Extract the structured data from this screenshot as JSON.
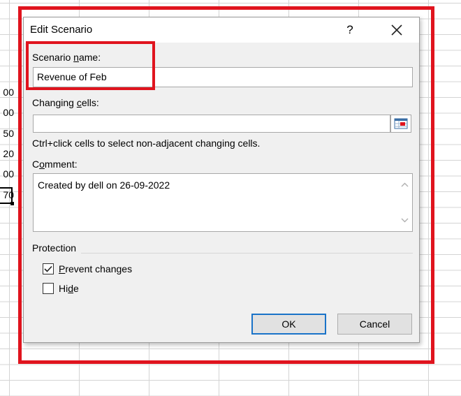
{
  "sheet": {
    "visible_values": [
      "00",
      "00",
      "50",
      "20",
      "00",
      "70"
    ]
  },
  "dialog": {
    "title": "Edit Scenario",
    "help_glyph": "?",
    "close_glyph": "×",
    "scenario_name": {
      "label_pre": "Scenario ",
      "label_accel": "n",
      "label_post": "ame:",
      "value": "Revenue of Feb"
    },
    "changing_cells": {
      "label_pre": "Changing ",
      "label_accel": "c",
      "label_post": "ells:",
      "value": ""
    },
    "hint": "Ctrl+click cells to select non-adjacent changing cells.",
    "comment": {
      "label_pre": "C",
      "label_accel": "o",
      "label_post": "mment:",
      "value": "Created by dell on 26-09-2022"
    },
    "protection": {
      "heading": "Protection",
      "prevent_changes": {
        "label_accel": "P",
        "label_post": "revent changes",
        "checked": true
      },
      "hide": {
        "label_pre": "Hi",
        "label_accel": "d",
        "label_post": "e",
        "checked": false
      }
    },
    "ok_label": "OK",
    "cancel_label": "Cancel"
  },
  "colors": {
    "highlight_red": "#e0141e",
    "ok_focus_blue": "#1a73c8"
  }
}
